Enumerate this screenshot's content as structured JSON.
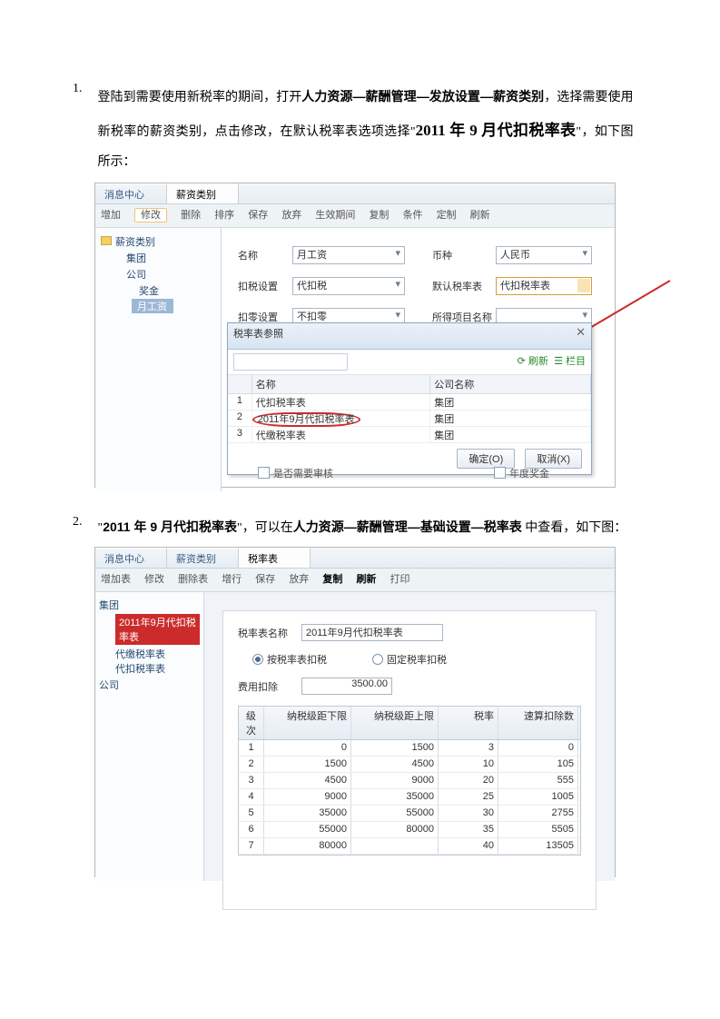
{
  "item1": {
    "num": "1.",
    "t1": "登陆到需要使用新税率的期间，打开",
    "b1": "人力资源—薪酬管理—发放设置—薪资类别",
    "t2": "，选择需要使用新税率的薪资类别，点击修改，在默认税率表选项选择\"",
    "big": "2011 年 9 月代扣税率表",
    "t3": "\"，如下图所示："
  },
  "shot1": {
    "tabs": [
      "消息中心",
      "薪资类别"
    ],
    "toolbar": [
      "增加",
      "修改",
      "删除",
      "排序",
      "保存",
      "放弃",
      "生效期间",
      "复制",
      "条件",
      "定制",
      "刷新"
    ],
    "tree": {
      "root": "薪资类别",
      "n1": "集团",
      "n2": "公司",
      "n3": "奖金",
      "sel": "月工资"
    },
    "form": {
      "r1a": "名称",
      "r1av": "月工资",
      "r1b": "币种",
      "r1bv": "人民币",
      "r2a": "扣税设置",
      "r2av": "代扣税",
      "r2b": "默认税率表",
      "r2bv": "代扣税率表",
      "r3a": "扣零设置",
      "r3av": "不扣零",
      "r3b": "所得项目名称"
    },
    "popup": {
      "title": "税率表参照",
      "refresh": "刷新",
      "cols": "栏目",
      "th": [
        "",
        "名称",
        "公司名称"
      ],
      "rows": [
        [
          "1",
          "代扣税率表",
          "集团"
        ],
        [
          "2",
          "2011年9月代扣税率表",
          "集团"
        ],
        [
          "3",
          "代缴税率表",
          "集团"
        ]
      ],
      "ok": "确定(O)",
      "cancel": "取消(X)"
    },
    "chk1": "是否需要审核",
    "chk2": "年度奖金"
  },
  "item2": {
    "num": "2.",
    "t1": "\"",
    "b1": "2011 年 9 月代扣税率表",
    "t2": "\"，可以在",
    "b2": "人力资源—薪酬管理—基础设置—税率表",
    "t3": " 中查看，如下图："
  },
  "shot2": {
    "tabs": [
      "消息中心",
      "薪资类别",
      "税率表"
    ],
    "toolbar": [
      "增加表",
      "修改",
      "删除表",
      "增行",
      "保存",
      "放弃",
      "复制",
      "刷新",
      "打印"
    ],
    "tree": {
      "root": "集团",
      "sel": "2011年9月代扣税率表",
      "n1": "代缴税率表",
      "n2": "代扣税率表",
      "n3": "公司"
    },
    "panel": {
      "lab1": "税率表名称",
      "val1": "2011年9月代扣税率表",
      "r1": "按税率表扣税",
      "r2": "固定税率扣税",
      "lab2": "费用扣除",
      "val2": "3500.00"
    }
  },
  "chart_data": {
    "type": "table",
    "title": "2011年9月代扣税率表",
    "columns": [
      "级次",
      "纳税级距下限",
      "纳税级距上限",
      "税率",
      "速算扣除数"
    ],
    "rows": [
      [
        1,
        0.0,
        1500,
        3,
        0.0
      ],
      [
        2,
        1500,
        4500,
        10,
        105
      ],
      [
        3,
        4500,
        9000,
        20,
        555
      ],
      [
        4,
        9000,
        35000,
        25,
        1005
      ],
      [
        5,
        35000,
        55000,
        30,
        2755
      ],
      [
        6,
        55000,
        80000,
        35,
        5505
      ],
      [
        7,
        80000,
        null,
        40,
        13505
      ]
    ]
  }
}
